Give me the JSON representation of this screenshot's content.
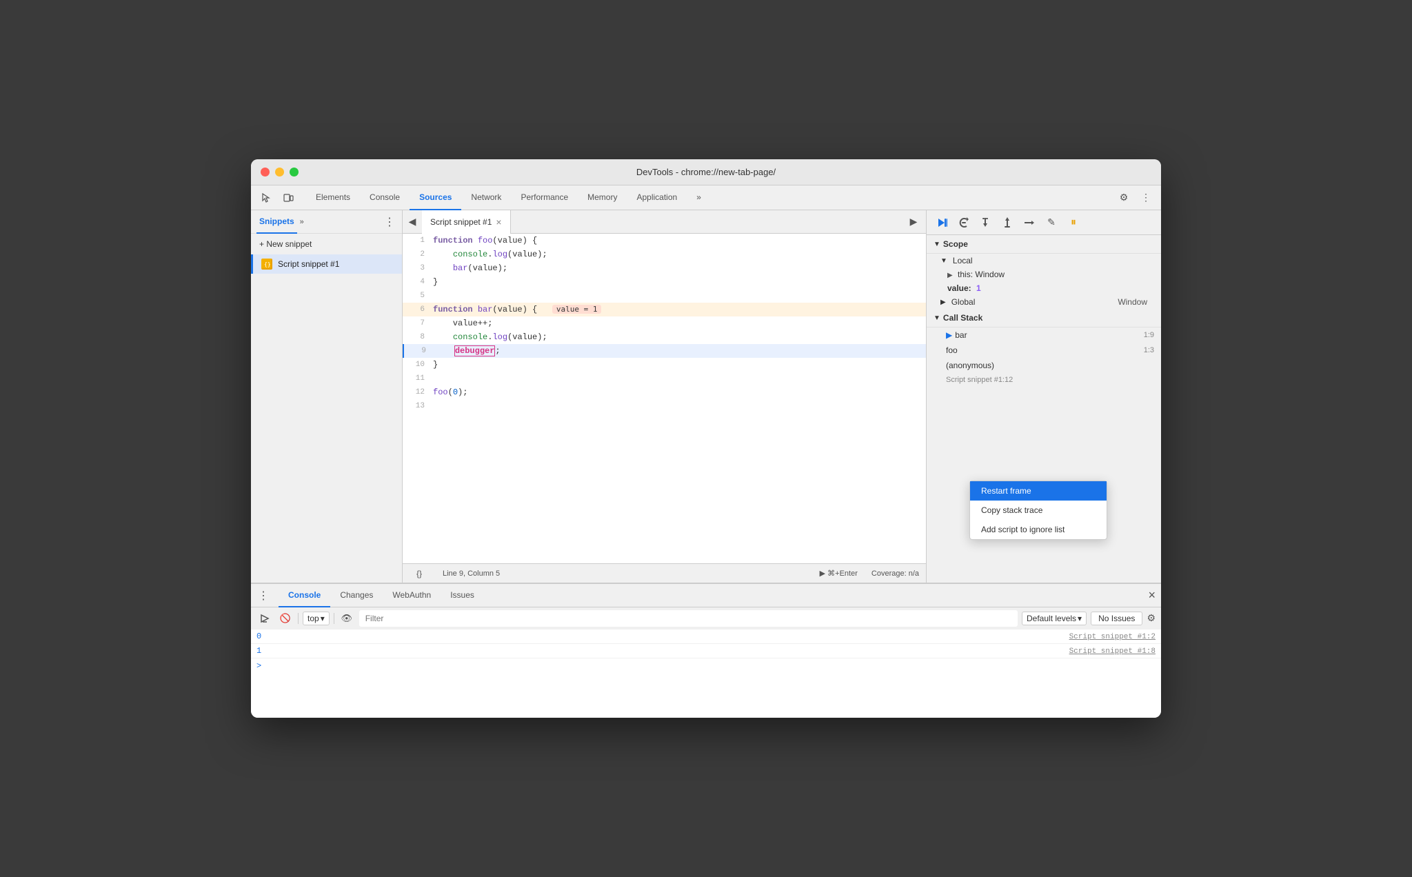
{
  "window": {
    "title": "DevTools - chrome://new-tab-page/"
  },
  "title_bar": {
    "close": "×",
    "minimize": "−",
    "maximize": "+"
  },
  "top_tabs": {
    "items": [
      {
        "label": "Elements",
        "active": false
      },
      {
        "label": "Console",
        "active": false
      },
      {
        "label": "Sources",
        "active": true
      },
      {
        "label": "Network",
        "active": false
      },
      {
        "label": "Performance",
        "active": false
      },
      {
        "label": "Memory",
        "active": false
      },
      {
        "label": "Application",
        "active": false
      }
    ],
    "more": "»",
    "settings_label": "⚙",
    "more_dots": "⋮"
  },
  "left_panel": {
    "tab_label": "Snippets",
    "tab_chevron": "»",
    "more_btn": "⋮",
    "new_snippet_label": "+ New snippet",
    "snippet_item_label": "Script snippet #1"
  },
  "editor": {
    "nav_back": "◀",
    "tab_label": "Script snippet #1",
    "tab_close": "×",
    "run_btn": "▶",
    "lines": [
      {
        "num": 1,
        "content": "function foo(value) {",
        "type": "normal"
      },
      {
        "num": 2,
        "content": "    console.log(value);",
        "type": "normal"
      },
      {
        "num": 3,
        "content": "    bar(value);",
        "type": "normal"
      },
      {
        "num": 4,
        "content": "}",
        "type": "normal"
      },
      {
        "num": 5,
        "content": "",
        "type": "normal"
      },
      {
        "num": 6,
        "content": "function bar(value) {",
        "type": "paused",
        "badge": "value = 1"
      },
      {
        "num": 7,
        "content": "    value++;",
        "type": "normal"
      },
      {
        "num": 8,
        "content": "    console.log(value);",
        "type": "normal"
      },
      {
        "num": 9,
        "content": "    debugger;",
        "type": "active"
      },
      {
        "num": 10,
        "content": "}",
        "type": "normal"
      },
      {
        "num": 11,
        "content": "",
        "type": "normal"
      },
      {
        "num": 12,
        "content": "foo(0);",
        "type": "normal"
      },
      {
        "num": 13,
        "content": "",
        "type": "normal"
      }
    ],
    "status_bar": {
      "format_btn": "{}",
      "position": "Line 9, Column 5",
      "run_label": "▶  ⌘+Enter",
      "coverage": "Coverage: n/a"
    }
  },
  "right_panel": {
    "toolbar": {
      "resume": "▶",
      "step_over": "↺",
      "step_into": "↓",
      "step_out": "↑",
      "step": "→",
      "deactivate": "✎",
      "pause": "⏸"
    },
    "scope": {
      "label": "Scope",
      "local_label": "Local",
      "this_label": "this: Window",
      "value_label": "value:",
      "value_val": "1",
      "global_label": "Global",
      "global_val": "Window"
    },
    "call_stack": {
      "label": "Call Stack",
      "items": [
        {
          "name": "bar",
          "loc": "1:9",
          "current": true
        },
        {
          "name": "foo",
          "loc": "1:3"
        },
        {
          "name": "(anonymous)",
          "loc": ""
        },
        {
          "src": "Script snippet #1:12"
        }
      ]
    }
  },
  "context_menu": {
    "items": [
      {
        "label": "Restart frame",
        "selected": true
      },
      {
        "label": "Copy stack trace"
      },
      {
        "label": "Add script to ignore list"
      }
    ]
  },
  "bottom_panel": {
    "more_btn": "⋮",
    "tabs": [
      {
        "label": "Console",
        "active": true
      },
      {
        "label": "Changes"
      },
      {
        "label": "WebAuthn"
      },
      {
        "label": "Issues"
      }
    ],
    "close_btn": "×",
    "toolbar": {
      "execute_btn": "▶",
      "clear_btn": "🚫",
      "context_label": "top",
      "context_chevron": "▾",
      "eye_btn": "👁",
      "filter_placeholder": "Filter",
      "levels_label": "Default levels",
      "levels_chevron": "▾",
      "no_issues": "No Issues",
      "settings_btn": "⚙"
    },
    "output": [
      {
        "value": "0",
        "src": "Script snippet #1:2"
      },
      {
        "value": "1",
        "src": "Script snippet #1:8"
      }
    ],
    "prompt": ">"
  }
}
